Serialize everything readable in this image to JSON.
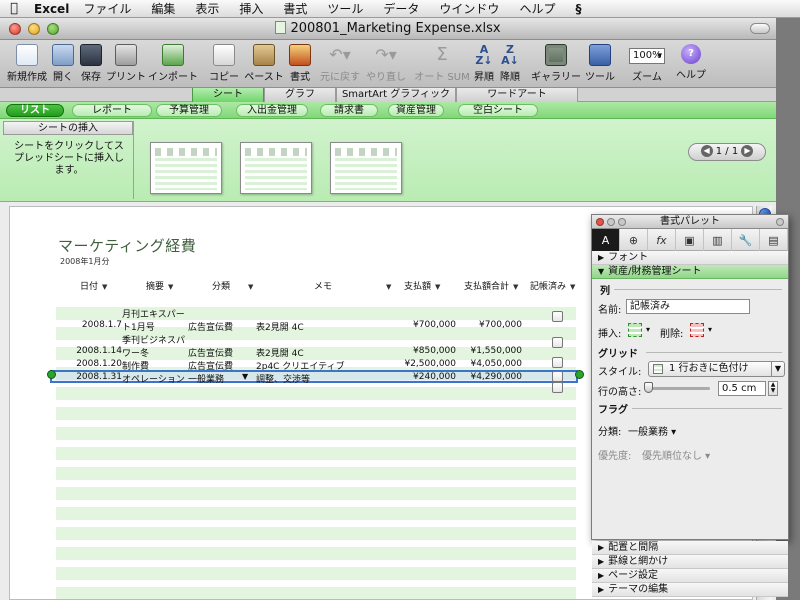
{
  "menubar": {
    "app": "Excel",
    "items": [
      "ファイル",
      "編集",
      "表示",
      "挿入",
      "書式",
      "ツール",
      "データ",
      "ウインドウ",
      "ヘルプ"
    ]
  },
  "window": {
    "title": "200801_Marketing Expense.xlsx"
  },
  "toolbar": {
    "new": "新規作成",
    "open": "開く",
    "save": "保存",
    "print": "プリント",
    "import": "インポート",
    "copy": "コピー",
    "paste": "ペースト",
    "format": "書式",
    "undo": "元に戻す",
    "redo": "やり直し",
    "autosum": "オート SUM",
    "sort_asc": "昇順",
    "sort_desc": "降順",
    "gallery": "ギャラリー",
    "tools": "ツール",
    "zoom_label": "ズーム",
    "zoom_value": "100%",
    "help": "ヘルプ"
  },
  "ribbon_tabs": [
    "シート",
    "グラフ",
    "SmartArt グラフィック",
    "ワードアート"
  ],
  "gallery": {
    "categories": [
      "リスト",
      "レポート",
      "予算管理",
      "入出金管理",
      "請求書",
      "資産管理",
      "空白シート"
    ],
    "insert_title": "シートの挿入",
    "insert_desc": "シートをクリックしてスプレッドシートに挿入します。",
    "pager": "1 / 1"
  },
  "sheet": {
    "title": "マーケティング経費",
    "subtitle": "2008年1月分",
    "headers": [
      "日付",
      "摘要",
      "分類",
      "メモ",
      "支払額",
      "支払額合計",
      "記帳済み"
    ],
    "rows": [
      {
        "date": "2008.1.7",
        "desc1": "月刊エキスパー",
        "desc2": "ト1月号",
        "category": "広告宣伝費",
        "memo": "表2見開 4C",
        "amount": "¥700,000",
        "total": "¥700,000"
      },
      {
        "date": "2008.1.14",
        "desc1": "季刊ビジネスパ",
        "desc2": "ワー冬",
        "category": "広告宣伝費",
        "memo": "表2見開 4C",
        "amount": "¥850,000",
        "total": "¥1,550,000"
      },
      {
        "date": "2008.1.20",
        "desc1": "",
        "desc2": "制作費",
        "category": "広告宣伝費",
        "memo": "2p4C クリエイティブ",
        "amount": "¥2,500,000",
        "total": "¥4,050,000"
      },
      {
        "date": "2008.1.31",
        "desc1": "",
        "desc2": "オペレーション",
        "category": "一般業務",
        "memo": "調整、交渉等",
        "amount": "¥240,000",
        "total": "¥4,290,000"
      }
    ]
  },
  "palette": {
    "title": "書式パレット",
    "sec_font": "フォント",
    "sec_finance": "資産/財務管理シート",
    "col_label": "列",
    "name_label": "名前:",
    "name_value": "記帳済み",
    "insert_label": "挿入:",
    "delete_label": "削除:",
    "grid_label": "グリッド",
    "style_label": "スタイル:",
    "style_value": "1 行おきに色付け",
    "height_label": "行の高さ:",
    "height_value": "0.5 cm",
    "flag_label": "フラグ",
    "class_label": "分類:",
    "class_value": "一般業務",
    "priority_label": "優先度:",
    "priority_value": "優先順位なし",
    "sec_layout": "配置と間隔",
    "sec_border": "罫線と網かけ",
    "sec_page": "ページ設定",
    "sec_theme": "テーマの編集"
  }
}
